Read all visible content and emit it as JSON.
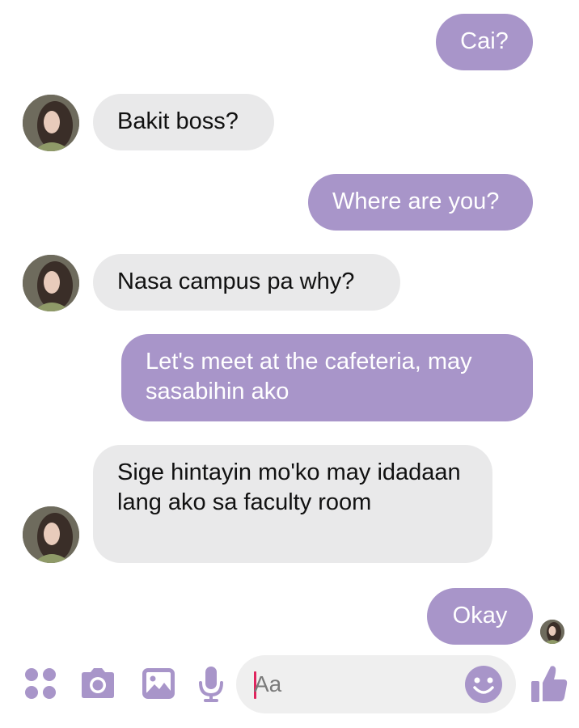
{
  "colors": {
    "outgoing_bubble": "#a895c9",
    "incoming_bubble": "#e9e9ea",
    "accent": "#a895c9"
  },
  "messages": [
    {
      "direction": "outgoing",
      "text": "Cai?"
    },
    {
      "direction": "incoming",
      "text": "Bakit boss?"
    },
    {
      "direction": "outgoing",
      "text": "Where are you?"
    },
    {
      "direction": "incoming",
      "text": "Nasa campus pa why?"
    },
    {
      "direction": "outgoing",
      "text": "Let's meet at the cafeteria, may sasabihin ako"
    },
    {
      "direction": "incoming",
      "text": "Sige hintayin mo'ko may idadaan lang ako sa faculty room"
    },
    {
      "direction": "outgoing",
      "text": "Okay"
    }
  ],
  "composer": {
    "placeholder": "Aa"
  },
  "toolbar": {
    "icons": [
      "grid-menu-icon",
      "camera-icon",
      "gallery-icon",
      "microphone-icon",
      "emoji-icon",
      "thumbs-up-icon"
    ]
  }
}
